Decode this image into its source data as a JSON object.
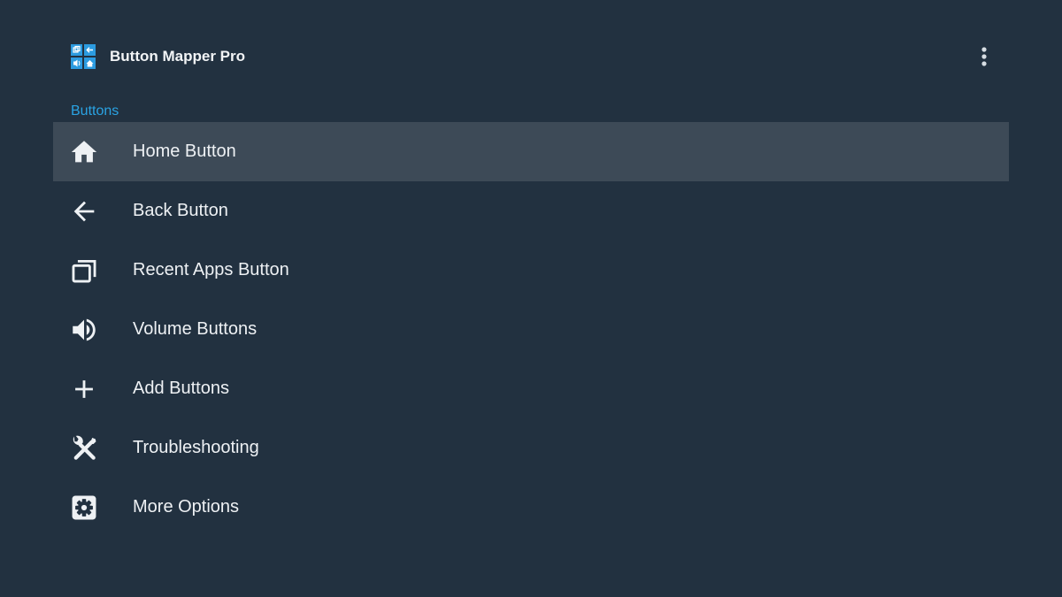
{
  "app": {
    "title": "Button Mapper Pro"
  },
  "section": {
    "header": "Buttons"
  },
  "menu": {
    "items": [
      {
        "label": "Home Button",
        "icon": "home-icon",
        "selected": true
      },
      {
        "label": "Back Button",
        "icon": "back-arrow-icon"
      },
      {
        "label": "Recent Apps Button",
        "icon": "recent-apps-icon"
      },
      {
        "label": "Volume Buttons",
        "icon": "volume-icon"
      },
      {
        "label": "Add Buttons",
        "icon": "plus-icon"
      },
      {
        "label": "Troubleshooting",
        "icon": "tools-icon"
      },
      {
        "label": "More Options",
        "icon": "settings-gear-icon"
      }
    ]
  },
  "colors": {
    "background": "#223140",
    "selected_row": "#3d4a57",
    "accent": "#2aa3e3",
    "text": "#eef1f4"
  }
}
